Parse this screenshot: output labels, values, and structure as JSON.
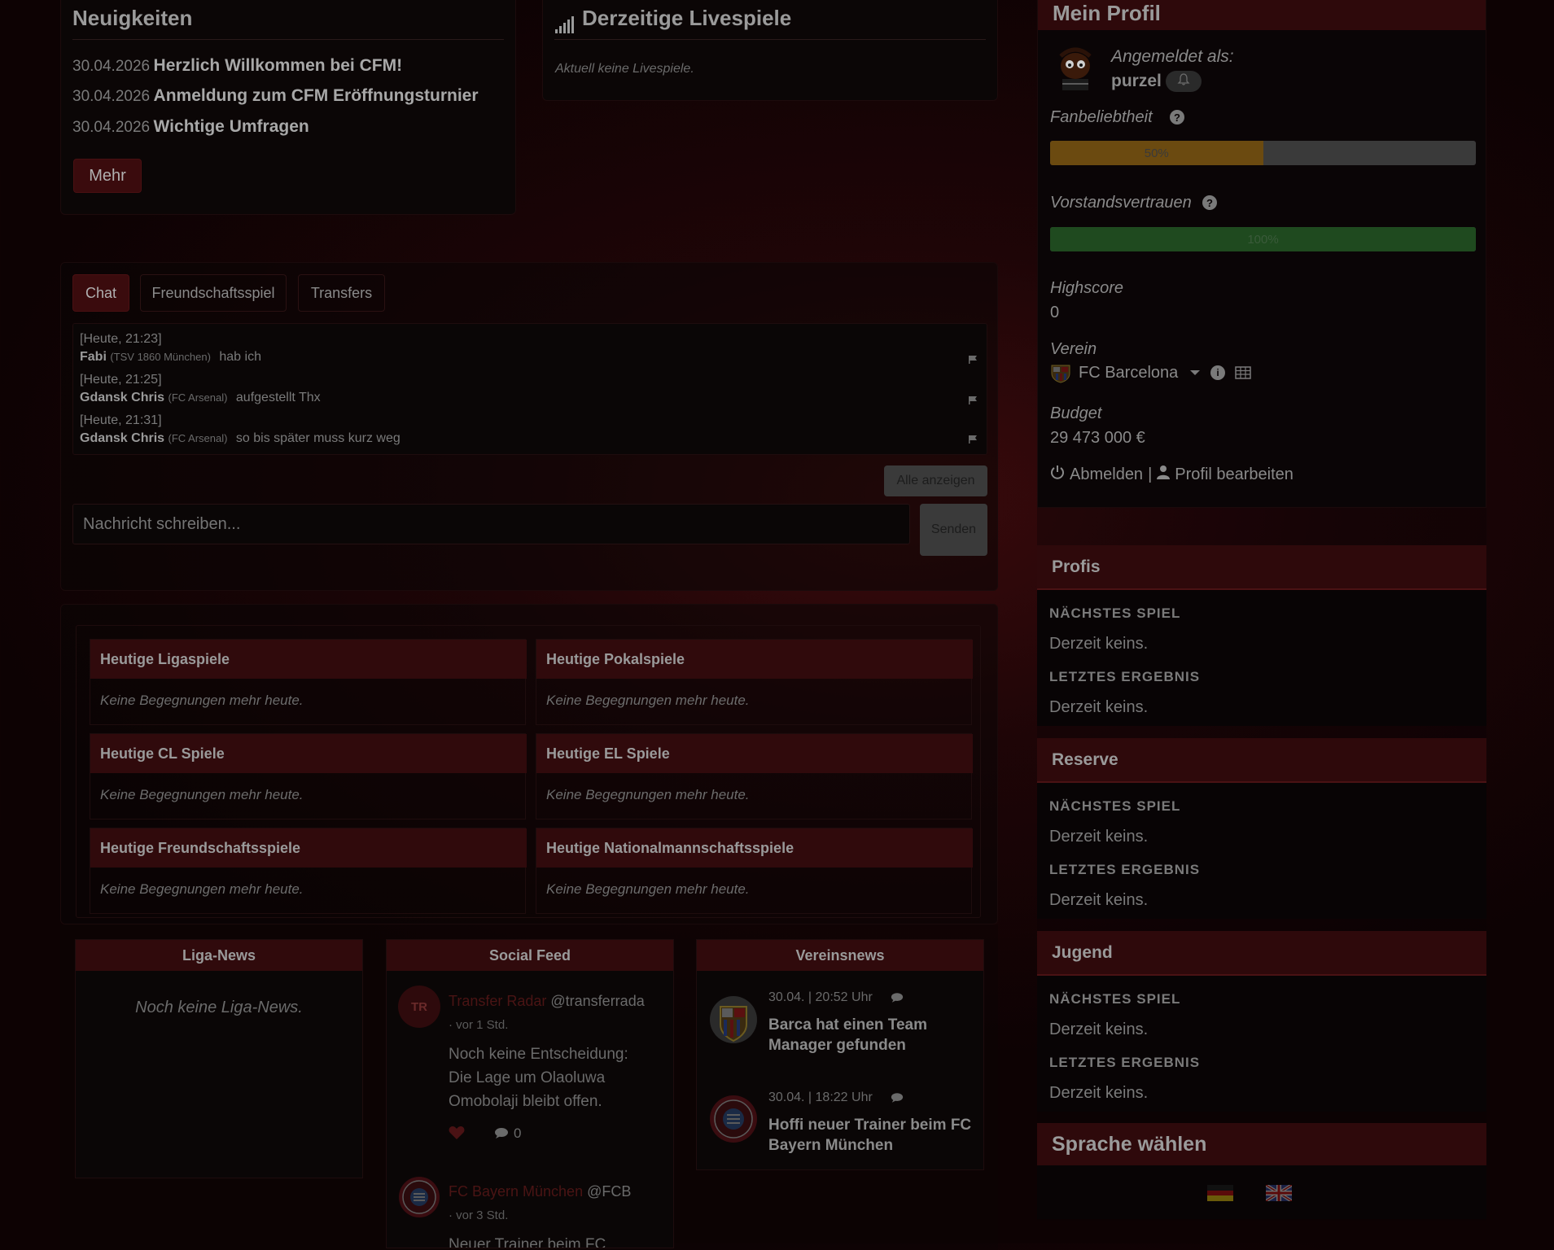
{
  "news": {
    "title": "Neuigkeiten",
    "items": [
      {
        "date": "30.04.2026",
        "title": "Herzlich Willkommen bei CFM!"
      },
      {
        "date": "30.04.2026",
        "title": "Anmeldung zum CFM Eröffnungsturnier"
      },
      {
        "date": "30.04.2026",
        "title": "Wichtige Umfragen"
      }
    ],
    "more_label": "Mehr"
  },
  "live": {
    "title": "Derzeitige Livespiele",
    "empty": "Aktuell keine Livespiele."
  },
  "chat": {
    "tabs": [
      "Chat",
      "Freundschaftsspiel",
      "Transfers"
    ],
    "messages": [
      {
        "time": "[Heute, 21:23]",
        "user": "Fabi",
        "club": "(TSV 1860 München)",
        "text": "hab ich"
      },
      {
        "time": "[Heute, 21:25]",
        "user": "Gdansk Chris",
        "club": "(FC Arsenal)",
        "text": "aufgestellt Thx"
      },
      {
        "time": "[Heute, 21:31]",
        "user": "Gdansk Chris",
        "club": "(FC Arsenal)",
        "text": "so bis später muss kurz weg"
      }
    ],
    "show_all": "Alle anzeigen",
    "placeholder": "Nachricht schreiben...",
    "send": "Senden"
  },
  "matches": {
    "empty": "Keine Begegnungen mehr heute.",
    "boxes": [
      "Heutige Ligaspiele",
      "Heutige Pokalspiele",
      "Heutige CL Spiele",
      "Heutige EL Spiele",
      "Heutige Freundschaftsspiele",
      "Heutige Nationalmannschaftsspiele"
    ]
  },
  "liga_news": {
    "title": "Liga-News",
    "empty": "Noch keine Liga-News."
  },
  "social": {
    "title": "Social Feed",
    "posts": [
      {
        "avatar": "TR",
        "name": "Transfer Radar",
        "handle": "@transferrada",
        "time": "· vor 1 Std.",
        "text": "Noch keine Entscheidung: Die Lage um Olaoluwa Omobolaji bleibt offen.",
        "comments": "0"
      },
      {
        "name": "FC Bayern München",
        "handle": "@FCB",
        "time": "· vor 3 Std.",
        "text": "Neuer Trainer beim FC"
      }
    ]
  },
  "vereinsnews": {
    "title": "Vereinsnews",
    "items": [
      {
        "date": "30.04. | 20:52 Uhr",
        "title": "Barca hat einen Team Manager gefunden",
        "logo": "FCB"
      },
      {
        "date": "30.04. | 18:22 Uhr",
        "title": "Hoffi neuer Trainer beim FC Bayern München",
        "logo": "FCB"
      }
    ]
  },
  "profile": {
    "title": "Mein Profil",
    "logged_in_as": "Angemeldet als:",
    "username": "purzel",
    "fan_label": "Fanbeliebtheit",
    "fan_value": "50%",
    "fan_fraction": 0.5,
    "board_label": "Vorstandsvertrauen",
    "board_value": "100%",
    "board_fraction": 1.0,
    "highscore_label": "Highscore",
    "highscore": "0",
    "club_label": "Verein",
    "club": "FC Barcelona",
    "budget_label": "Budget",
    "budget": "29 473 000 €",
    "logout": "Abmelden",
    "separator": "|",
    "edit": "Profil bearbeiten"
  },
  "teams": [
    {
      "title": "Profis",
      "next_label": "NÄCHSTES SPIEL",
      "next": "Derzeit keins.",
      "last_label": "LETZTES ERGEBNIS",
      "last": "Derzeit keins."
    },
    {
      "title": "Reserve",
      "next_label": "NÄCHSTES SPIEL",
      "next": "Derzeit keins.",
      "last_label": "LETZTES ERGEBNIS",
      "last": "Derzeit keins."
    },
    {
      "title": "Jugend",
      "next_label": "NÄCHSTES SPIEL",
      "next": "Derzeit keins.",
      "last_label": "LETZTES ERGEBNIS",
      "last": "Derzeit keins."
    }
  ],
  "language": {
    "title": "Sprache wählen"
  },
  "colors": {
    "accent": "#300a0c",
    "fan_bar": "#6b4a10",
    "board_bar": "#1f4a1f"
  }
}
